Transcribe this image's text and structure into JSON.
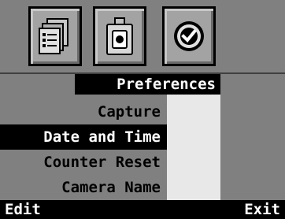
{
  "toolbar": {
    "buttons": [
      {
        "icon": "documents-icon"
      },
      {
        "icon": "camera-icon"
      },
      {
        "icon": "checkmark-icon"
      }
    ]
  },
  "menu": {
    "title": "Preferences",
    "items": [
      {
        "label": "Capture"
      },
      {
        "label": "Date and Time",
        "selected": true
      },
      {
        "label": "Counter Reset"
      },
      {
        "label": "Camera Name"
      }
    ]
  },
  "softkeys": {
    "left": "Edit",
    "right": "Exit"
  }
}
